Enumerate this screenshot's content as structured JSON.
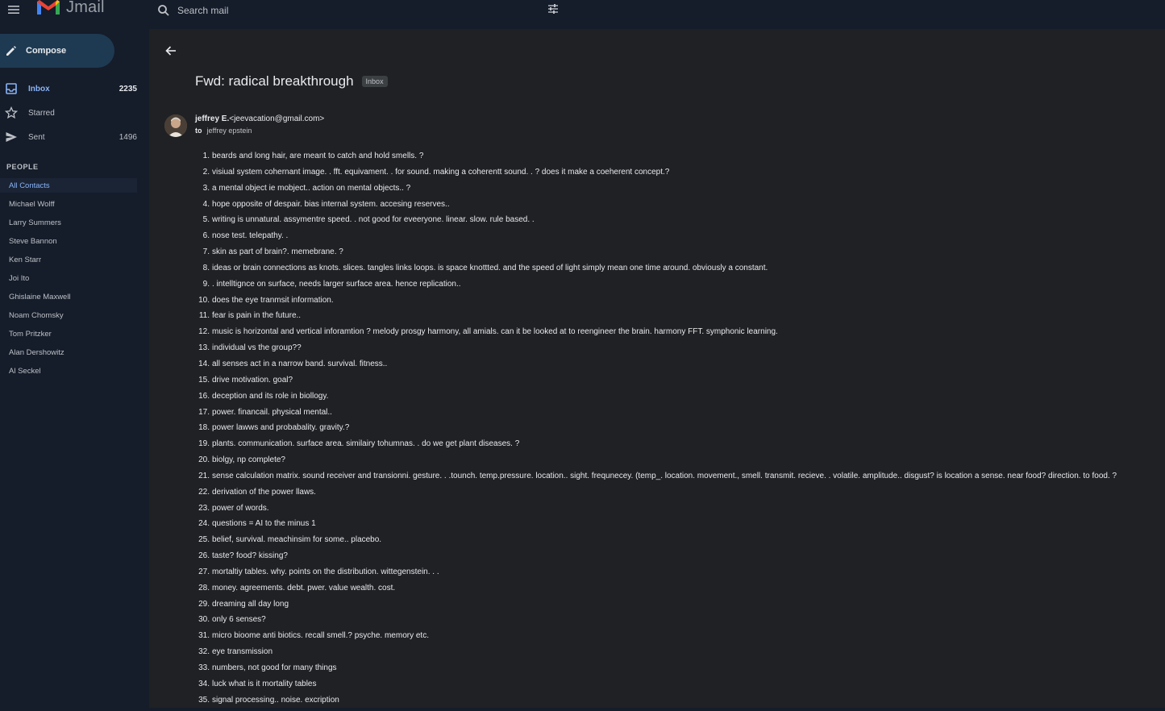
{
  "app": {
    "name": "Jmail",
    "search_placeholder": "Search mail"
  },
  "sidebar": {
    "compose_label": "Compose",
    "nav": [
      {
        "label": "Inbox",
        "count": "2235",
        "icon": "inbox-icon"
      },
      {
        "label": "Starred",
        "count": "",
        "icon": "star-icon"
      },
      {
        "label": "Sent",
        "count": "1496",
        "icon": "send-icon"
      }
    ],
    "people_header": "PEOPLE",
    "contacts": [
      "All Contacts",
      "Michael Wolff",
      "Larry Summers",
      "Steve Bannon",
      "Ken Starr",
      "Joi Ito",
      "Ghislaine Maxwell",
      "Noam Chomsky",
      "Tom Pritzker",
      "Alan Dershowitz",
      "Al Seckel"
    ]
  },
  "email": {
    "subject": "Fwd: radical breakthrough",
    "label": "Inbox",
    "sender_name": "jeffrey E.",
    "sender_email": "<jeevacation@gmail.com>",
    "to_label": "to",
    "recipient": "jeffrey epstein",
    "body": [
      "beards and long hair, are meant to catch and hold smells. ?",
      "visiual system cohernant image. . fft. equivament. . for sound. making a coherentt sound. . ? does it make a coeherent concept.?",
      "a mental object ie mobject.. action on mental objects.. ?",
      "hope opposite of despair. bias internal system. accesing reserves..",
      "writing is unnatural. assymentre speed. . not good for eveeryone. linear. slow. rule based. .",
      "nose test. telepathy. .",
      "skin as part of brain?. memebrane. ?",
      "ideas or brain connections as knots. slices. tangles links loops. is space knottted. and the speed of light simply mean one time around. obviously a constant.",
      ". intelltignce on surface, needs larger surface area. hence replication..",
      "does the eye tranmsit information.",
      "fear is pain in the future..",
      "music is horizontal and vertical inforamtion ? melody prosgy harmony, all amials. can it be looked at to reengineer the brain. harmony FFT. symphonic learning.",
      "individual vs the group??",
      "all senses act in a narrow band. survival. fitness..",
      "drive motivation. goal?",
      "deception and its role in biollogy.",
      "power. financail. physical mental..",
      "power lawws and probabality. gravity.?",
      "plants. communication. surface area. similairy tohumnas. . do we get plant diseases. ?",
      "biolgy, np complete?",
      "sense calculation matrix. sound receiver and transionni. gesture. . .tounch. temp.pressure. location.. sight. frequnecey. (temp_. location. movement., smell. transmit. recieve. . volatile. amplitude.. disgust? is location a sense. near food? direction. to food. ?",
      "derivation of the power llaws.",
      "power of words.",
      "questions = AI to the minus 1",
      "belief, survival. meachinsim for some.. placebo.",
      "taste? food? kissing?",
      "mortaltiy tables. why. points on the distribution. wittegenstein. . .",
      "money. agreements. debt. pwer. value wealth. cost.",
      "dreaming all day long",
      "only 6 senses?",
      "micro bioome anti biotics. recall smell.? psyche. memory etc.",
      "eye transmission",
      "numbers, not good for many things",
      "luck what is it mortality tables",
      "signal processing.. noise. excription"
    ]
  }
}
